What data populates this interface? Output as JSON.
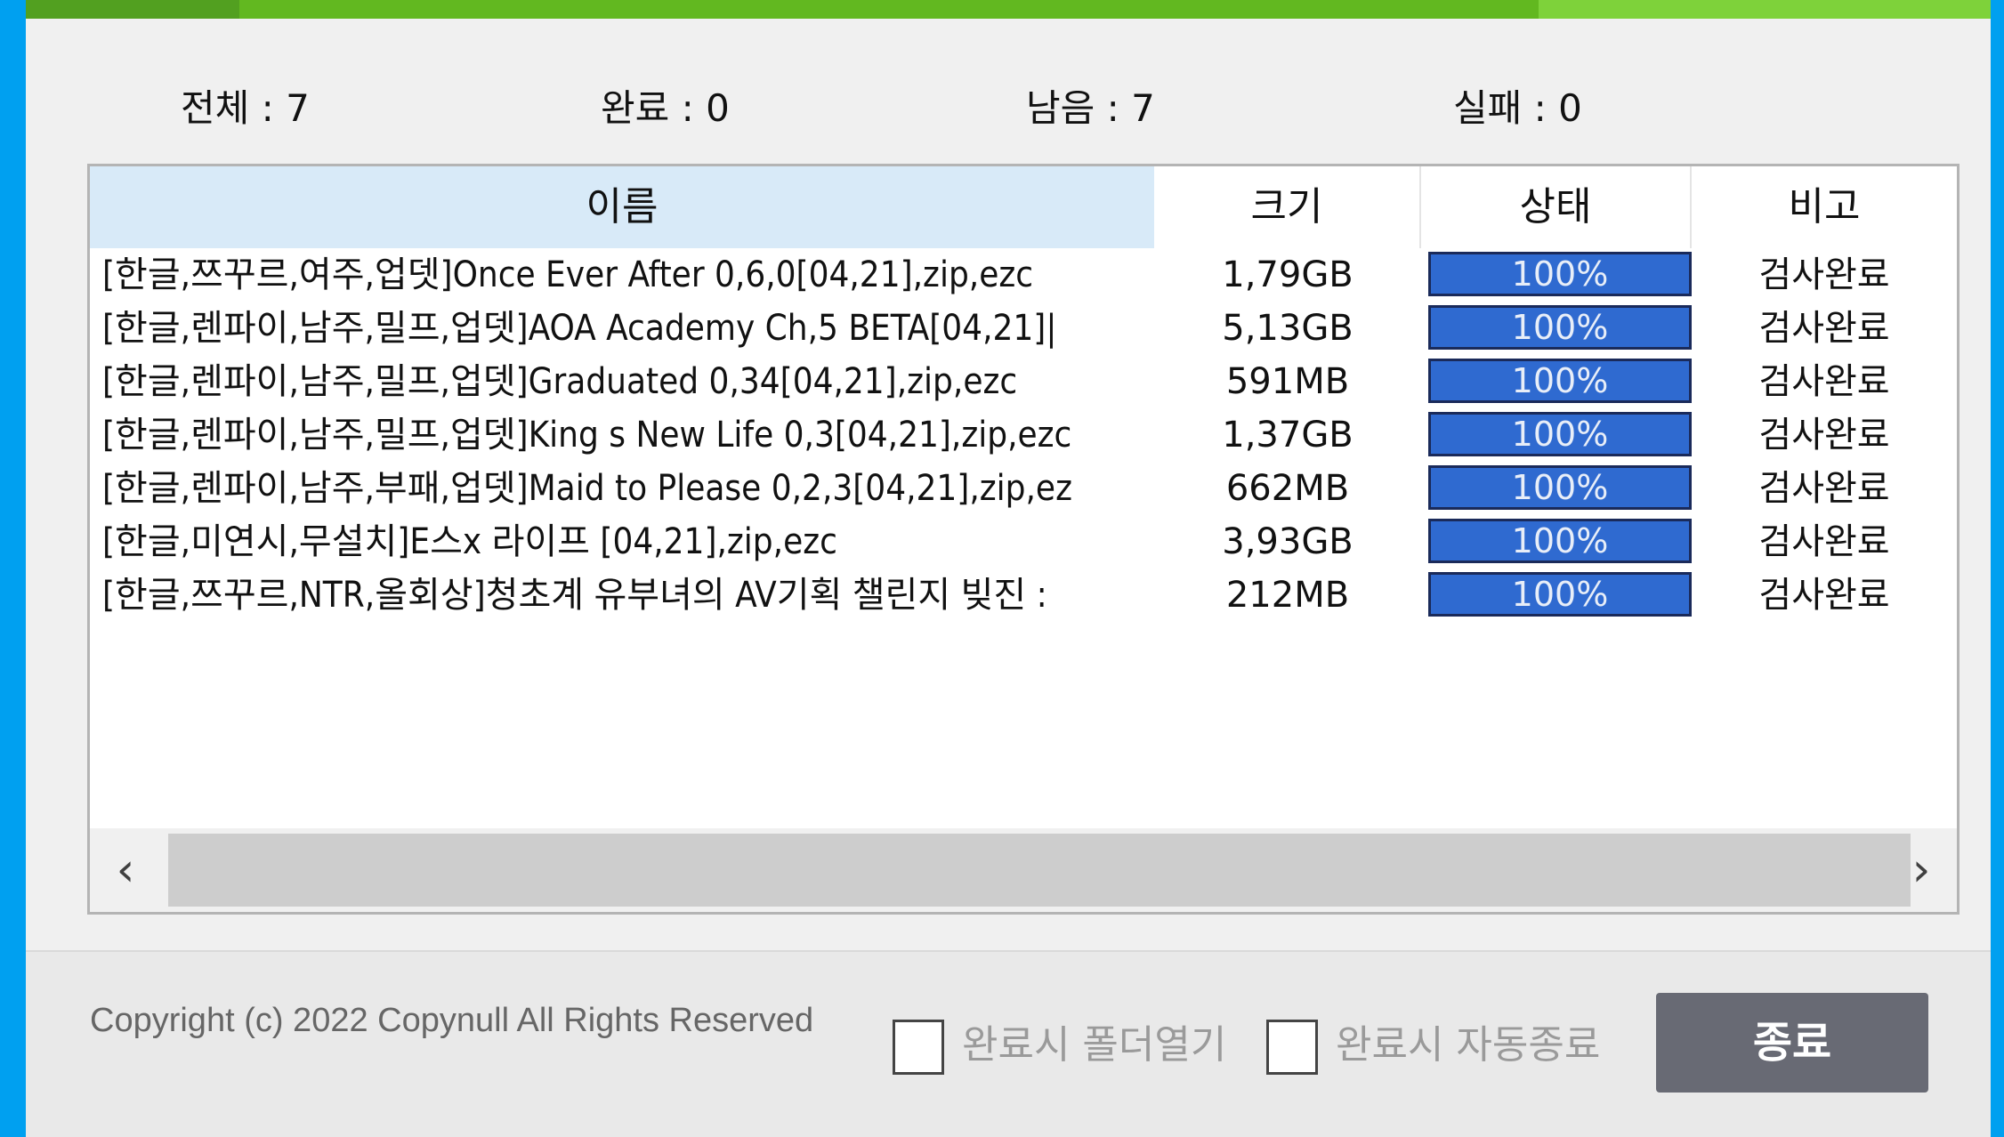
{
  "progress": {
    "fraction": 0.77,
    "color": "#7ed23a"
  },
  "counters": {
    "total": "전체 : 7",
    "done": "완료 : 0",
    "remaining": "남음 : 7",
    "failed": "실패 : 0"
  },
  "table": {
    "headers": {
      "name": "이름",
      "size": "크기",
      "status": "상태",
      "note": "비고"
    },
    "rows": [
      {
        "name": "[한글,쯔꾸르,여주,업뎃]Once Ever After 0,6,0[04,21],zip,ezc",
        "size": "1,79GB",
        "status": "100%",
        "progress": 1.0,
        "note": "검사완료"
      },
      {
        "name": "[한글,렌파이,남주,밀프,업뎃]AOA Academy Ch,5 BETA[04,21]|",
        "size": "5,13GB",
        "status": "100%",
        "progress": 1.0,
        "note": "검사완료"
      },
      {
        "name": "[한글,렌파이,남주,밀프,업뎃]Graduated 0,34[04,21],zip,ezc",
        "size": "591MB",
        "status": "100%",
        "progress": 1.0,
        "note": "검사완료"
      },
      {
        "name": "[한글,렌파이,남주,밀프,업뎃]King s New Life 0,3[04,21],zip,ezc",
        "size": "1,37GB",
        "status": "100%",
        "progress": 1.0,
        "note": "검사완료"
      },
      {
        "name": "[한글,렌파이,남주,부패,업뎃]Maid to Please 0,2,3[04,21],zip,ez",
        "size": "662MB",
        "status": "100%",
        "progress": 1.0,
        "note": "검사완료"
      },
      {
        "name": "[한글,미연시,무설치]E스x 라이프 [04,21],zip,ezc",
        "size": "3,93GB",
        "status": "100%",
        "progress": 1.0,
        "note": "검사완료"
      },
      {
        "name": "[한글,쯔꾸르,NTR,올회상]청초계 유부녀의 AV기획 챌린지 빚진 :",
        "size": "212MB",
        "status": "100%",
        "progress": 1.0,
        "note": "검사완료"
      }
    ]
  },
  "footer": {
    "copyright": "Copyright (c) 2022 Copynull All Rights Reserved",
    "checkbox_open_folder": {
      "label": "완료시 폴더열기",
      "checked": false
    },
    "checkbox_auto_exit": {
      "label": "완료시 자동종료",
      "checked": false
    },
    "exit_label": "종료"
  },
  "icons": {
    "scroll_left": "chevron-left-icon",
    "scroll_right": "chevron-right-icon"
  }
}
